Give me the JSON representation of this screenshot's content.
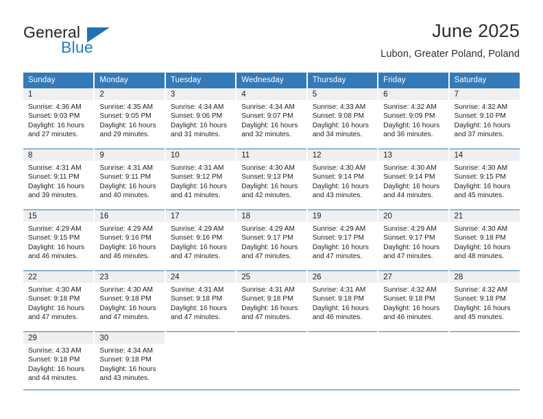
{
  "brand": {
    "name_top": "General",
    "name_bottom": "Blue",
    "triangle_color": "#1f72b8",
    "blue_text_color": "#1f7fc4"
  },
  "header": {
    "title": "June 2025",
    "subtitle": "Lubon, Greater Poland, Poland"
  },
  "theme": {
    "header_blue": "#3479b8",
    "daynum_band": "#efefef",
    "text": "#1d1d1d"
  },
  "weekday_headers": [
    "Sunday",
    "Monday",
    "Tuesday",
    "Wednesday",
    "Thursday",
    "Friday",
    "Saturday"
  ],
  "weeks": [
    [
      {
        "day": "1",
        "sunrise": "Sunrise: 4:36 AM",
        "sunset": "Sunset: 9:03 PM",
        "daylight1": "Daylight: 16 hours",
        "daylight2": "and 27 minutes."
      },
      {
        "day": "2",
        "sunrise": "Sunrise: 4:35 AM",
        "sunset": "Sunset: 9:05 PM",
        "daylight1": "Daylight: 16 hours",
        "daylight2": "and 29 minutes."
      },
      {
        "day": "3",
        "sunrise": "Sunrise: 4:34 AM",
        "sunset": "Sunset: 9:06 PM",
        "daylight1": "Daylight: 16 hours",
        "daylight2": "and 31 minutes."
      },
      {
        "day": "4",
        "sunrise": "Sunrise: 4:34 AM",
        "sunset": "Sunset: 9:07 PM",
        "daylight1": "Daylight: 16 hours",
        "daylight2": "and 32 minutes."
      },
      {
        "day": "5",
        "sunrise": "Sunrise: 4:33 AM",
        "sunset": "Sunset: 9:08 PM",
        "daylight1": "Daylight: 16 hours",
        "daylight2": "and 34 minutes."
      },
      {
        "day": "6",
        "sunrise": "Sunrise: 4:32 AM",
        "sunset": "Sunset: 9:09 PM",
        "daylight1": "Daylight: 16 hours",
        "daylight2": "and 36 minutes."
      },
      {
        "day": "7",
        "sunrise": "Sunrise: 4:32 AM",
        "sunset": "Sunset: 9:10 PM",
        "daylight1": "Daylight: 16 hours",
        "daylight2": "and 37 minutes."
      }
    ],
    [
      {
        "day": "8",
        "sunrise": "Sunrise: 4:31 AM",
        "sunset": "Sunset: 9:11 PM",
        "daylight1": "Daylight: 16 hours",
        "daylight2": "and 39 minutes."
      },
      {
        "day": "9",
        "sunrise": "Sunrise: 4:31 AM",
        "sunset": "Sunset: 9:11 PM",
        "daylight1": "Daylight: 16 hours",
        "daylight2": "and 40 minutes."
      },
      {
        "day": "10",
        "sunrise": "Sunrise: 4:31 AM",
        "sunset": "Sunset: 9:12 PM",
        "daylight1": "Daylight: 16 hours",
        "daylight2": "and 41 minutes."
      },
      {
        "day": "11",
        "sunrise": "Sunrise: 4:30 AM",
        "sunset": "Sunset: 9:13 PM",
        "daylight1": "Daylight: 16 hours",
        "daylight2": "and 42 minutes."
      },
      {
        "day": "12",
        "sunrise": "Sunrise: 4:30 AM",
        "sunset": "Sunset: 9:14 PM",
        "daylight1": "Daylight: 16 hours",
        "daylight2": "and 43 minutes."
      },
      {
        "day": "13",
        "sunrise": "Sunrise: 4:30 AM",
        "sunset": "Sunset: 9:14 PM",
        "daylight1": "Daylight: 16 hours",
        "daylight2": "and 44 minutes."
      },
      {
        "day": "14",
        "sunrise": "Sunrise: 4:30 AM",
        "sunset": "Sunset: 9:15 PM",
        "daylight1": "Daylight: 16 hours",
        "daylight2": "and 45 minutes."
      }
    ],
    [
      {
        "day": "15",
        "sunrise": "Sunrise: 4:29 AM",
        "sunset": "Sunset: 9:15 PM",
        "daylight1": "Daylight: 16 hours",
        "daylight2": "and 46 minutes."
      },
      {
        "day": "16",
        "sunrise": "Sunrise: 4:29 AM",
        "sunset": "Sunset: 9:16 PM",
        "daylight1": "Daylight: 16 hours",
        "daylight2": "and 46 minutes."
      },
      {
        "day": "17",
        "sunrise": "Sunrise: 4:29 AM",
        "sunset": "Sunset: 9:16 PM",
        "daylight1": "Daylight: 16 hours",
        "daylight2": "and 47 minutes."
      },
      {
        "day": "18",
        "sunrise": "Sunrise: 4:29 AM",
        "sunset": "Sunset: 9:17 PM",
        "daylight1": "Daylight: 16 hours",
        "daylight2": "and 47 minutes."
      },
      {
        "day": "19",
        "sunrise": "Sunrise: 4:29 AM",
        "sunset": "Sunset: 9:17 PM",
        "daylight1": "Daylight: 16 hours",
        "daylight2": "and 47 minutes."
      },
      {
        "day": "20",
        "sunrise": "Sunrise: 4:29 AM",
        "sunset": "Sunset: 9:17 PM",
        "daylight1": "Daylight: 16 hours",
        "daylight2": "and 47 minutes."
      },
      {
        "day": "21",
        "sunrise": "Sunrise: 4:30 AM",
        "sunset": "Sunset: 9:18 PM",
        "daylight1": "Daylight: 16 hours",
        "daylight2": "and 48 minutes."
      }
    ],
    [
      {
        "day": "22",
        "sunrise": "Sunrise: 4:30 AM",
        "sunset": "Sunset: 9:18 PM",
        "daylight1": "Daylight: 16 hours",
        "daylight2": "and 47 minutes."
      },
      {
        "day": "23",
        "sunrise": "Sunrise: 4:30 AM",
        "sunset": "Sunset: 9:18 PM",
        "daylight1": "Daylight: 16 hours",
        "daylight2": "and 47 minutes."
      },
      {
        "day": "24",
        "sunrise": "Sunrise: 4:31 AM",
        "sunset": "Sunset: 9:18 PM",
        "daylight1": "Daylight: 16 hours",
        "daylight2": "and 47 minutes."
      },
      {
        "day": "25",
        "sunrise": "Sunrise: 4:31 AM",
        "sunset": "Sunset: 9:18 PM",
        "daylight1": "Daylight: 16 hours",
        "daylight2": "and 47 minutes."
      },
      {
        "day": "26",
        "sunrise": "Sunrise: 4:31 AM",
        "sunset": "Sunset: 9:18 PM",
        "daylight1": "Daylight: 16 hours",
        "daylight2": "and 46 minutes."
      },
      {
        "day": "27",
        "sunrise": "Sunrise: 4:32 AM",
        "sunset": "Sunset: 9:18 PM",
        "daylight1": "Daylight: 16 hours",
        "daylight2": "and 46 minutes."
      },
      {
        "day": "28",
        "sunrise": "Sunrise: 4:32 AM",
        "sunset": "Sunset: 9:18 PM",
        "daylight1": "Daylight: 16 hours",
        "daylight2": "and 45 minutes."
      }
    ],
    [
      {
        "day": "29",
        "sunrise": "Sunrise: 4:33 AM",
        "sunset": "Sunset: 9:18 PM",
        "daylight1": "Daylight: 16 hours",
        "daylight2": "and 44 minutes."
      },
      {
        "day": "30",
        "sunrise": "Sunrise: 4:34 AM",
        "sunset": "Sunset: 9:18 PM",
        "daylight1": "Daylight: 16 hours",
        "daylight2": "and 43 minutes."
      },
      {
        "day": "",
        "sunrise": "",
        "sunset": "",
        "daylight1": "",
        "daylight2": ""
      },
      {
        "day": "",
        "sunrise": "",
        "sunset": "",
        "daylight1": "",
        "daylight2": ""
      },
      {
        "day": "",
        "sunrise": "",
        "sunset": "",
        "daylight1": "",
        "daylight2": ""
      },
      {
        "day": "",
        "sunrise": "",
        "sunset": "",
        "daylight1": "",
        "daylight2": ""
      },
      {
        "day": "",
        "sunrise": "",
        "sunset": "",
        "daylight1": "",
        "daylight2": ""
      }
    ]
  ]
}
